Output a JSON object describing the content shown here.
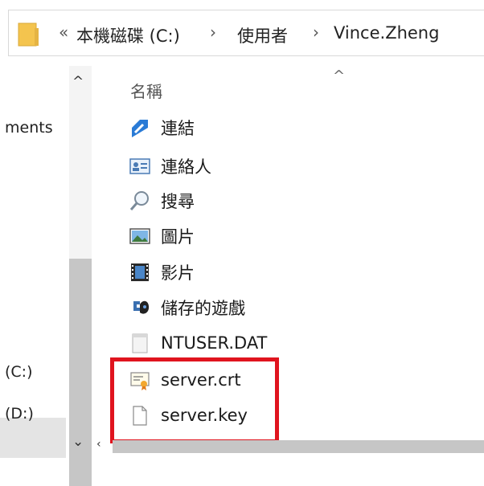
{
  "breadcrumb": {
    "overflow": "«",
    "separator": "›",
    "items": [
      "本機磁碟 (C:)",
      "使用者",
      "Vince.Zheng"
    ]
  },
  "nav": {
    "items": [
      "ments",
      "(C:)",
      "(D:)"
    ],
    "scroll_up": "^",
    "scroll_down": "⌄"
  },
  "content": {
    "column_header": "名稱",
    "sort_indicator": "^",
    "files": [
      {
        "name": "連結",
        "icon": "links-icon"
      },
      {
        "name": "連絡人",
        "icon": "contacts-icon"
      },
      {
        "name": "搜尋",
        "icon": "search-icon"
      },
      {
        "name": "圖片",
        "icon": "pictures-icon"
      },
      {
        "name": "影片",
        "icon": "videos-icon"
      },
      {
        "name": "儲存的遊戲",
        "icon": "saved-games-icon"
      },
      {
        "name": "NTUSER.DAT",
        "icon": "file-icon"
      },
      {
        "name": "server.crt",
        "icon": "certificate-icon"
      },
      {
        "name": "server.key",
        "icon": "file-icon"
      }
    ]
  },
  "colors": {
    "highlight": "#e0141e",
    "folder": "#f4c44e"
  }
}
